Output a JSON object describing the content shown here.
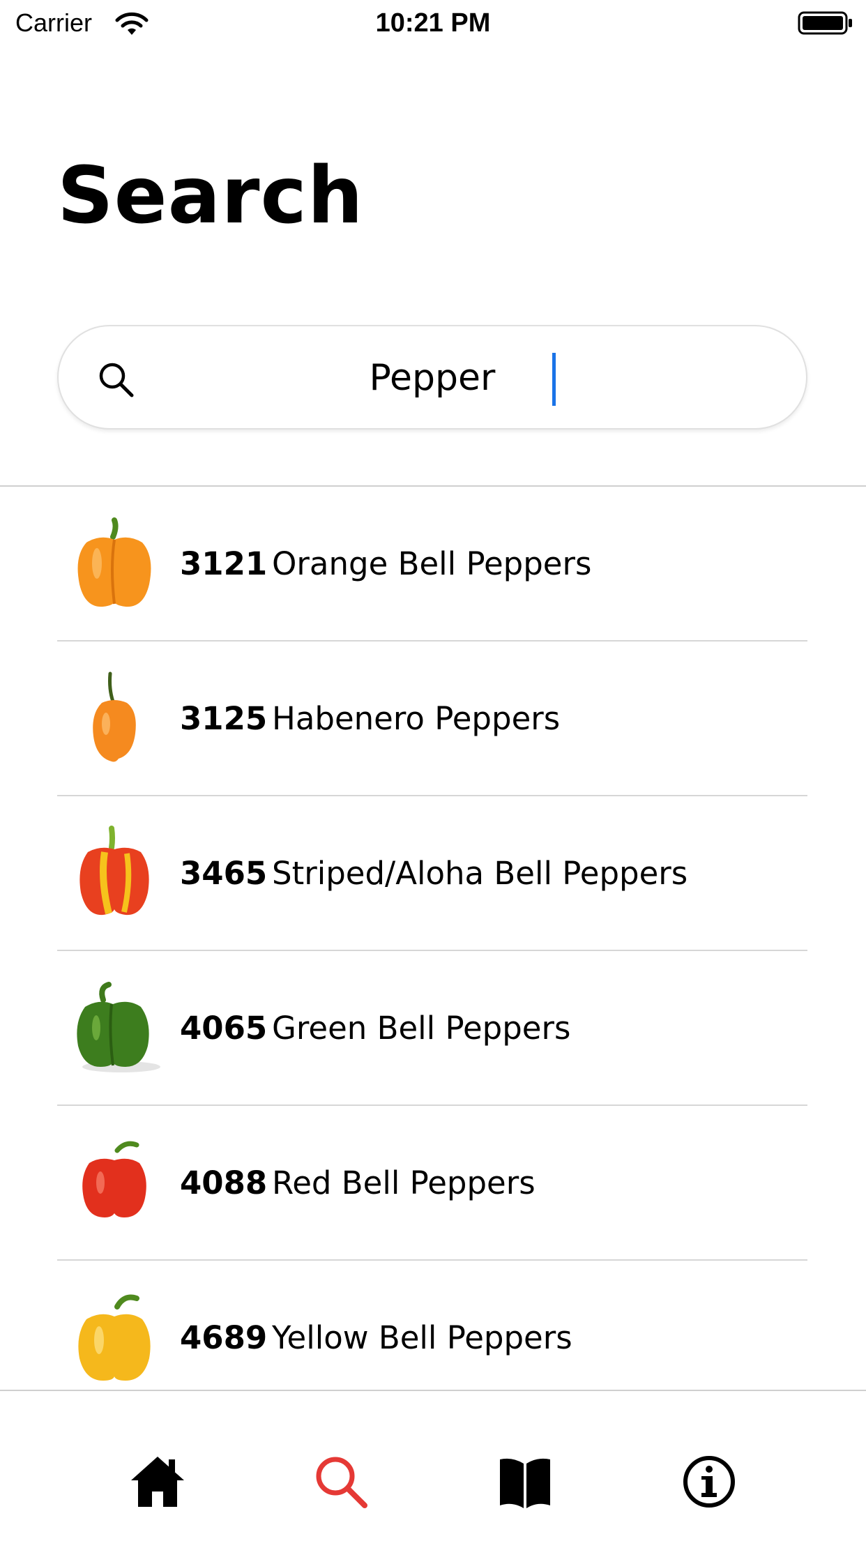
{
  "status_bar": {
    "carrier": "Carrier",
    "time": "10:21 PM",
    "icons": [
      "wifi-icon",
      "battery-icon"
    ]
  },
  "page": {
    "title": "Search"
  },
  "search": {
    "value": "Pepper",
    "icon": "search-icon"
  },
  "results": [
    {
      "code": "3121",
      "name": "Orange Bell Peppers",
      "image": "orange-bell-pepper"
    },
    {
      "code": "3125",
      "name": "Habenero Peppers",
      "image": "habanero-pepper"
    },
    {
      "code": "3465",
      "name": "Striped/Aloha Bell Peppers",
      "image": "striped-bell-pepper"
    },
    {
      "code": "4065",
      "name": "Green Bell Peppers",
      "image": "green-bell-pepper"
    },
    {
      "code": "4088",
      "name": "Red Bell Peppers",
      "image": "red-bell-pepper"
    },
    {
      "code": "4689",
      "name": "Yellow Bell Peppers",
      "image": "yellow-bell-pepper"
    }
  ],
  "tab_bar": {
    "tabs": [
      {
        "icon": "home-icon",
        "active": false
      },
      {
        "icon": "search-icon",
        "active": true
      },
      {
        "icon": "book-icon",
        "active": false
      },
      {
        "icon": "info-icon",
        "active": false
      }
    ],
    "active_color": "#e53935",
    "inactive_color": "#000000"
  }
}
